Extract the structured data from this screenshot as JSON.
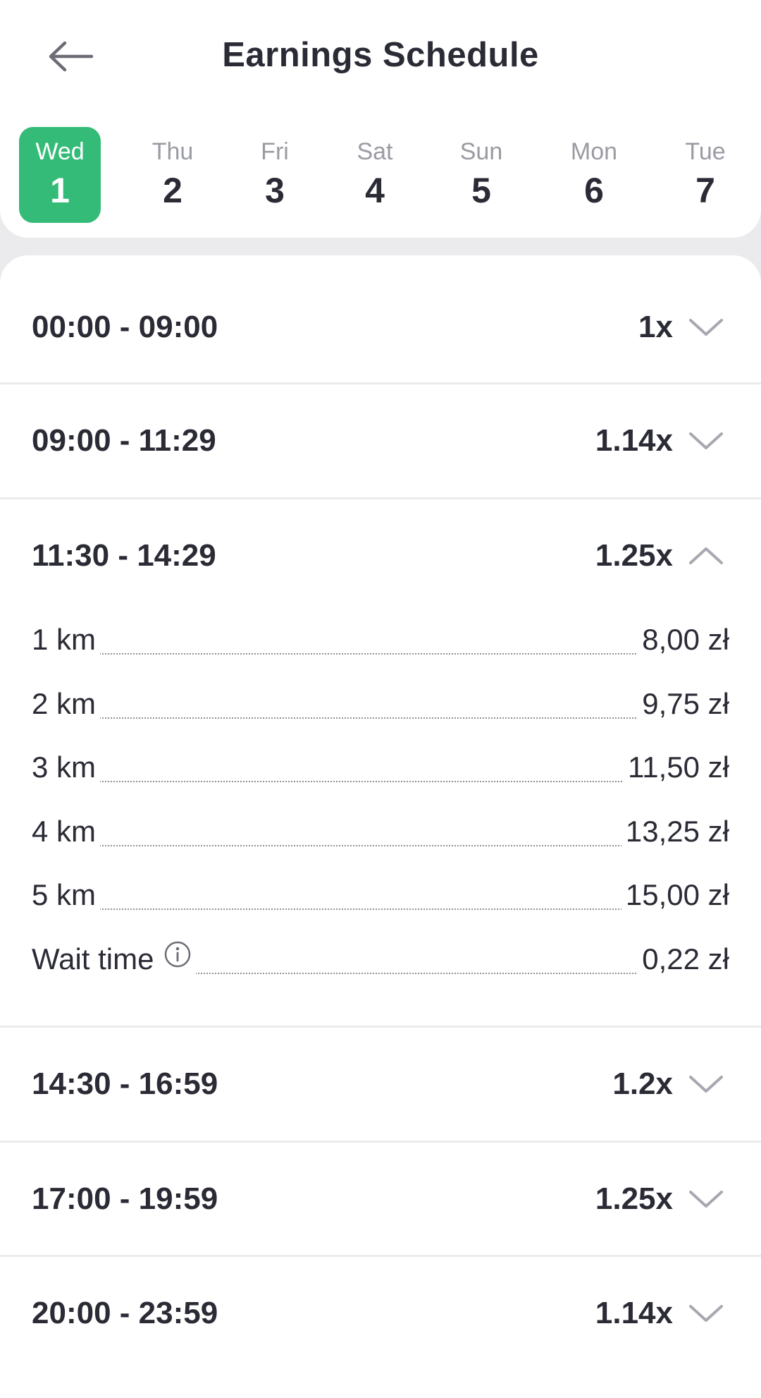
{
  "header": {
    "title": "Earnings Schedule"
  },
  "days": [
    {
      "name": "Wed",
      "num": "1",
      "selected": true
    },
    {
      "name": "Thu",
      "num": "2"
    },
    {
      "name": "Fri",
      "num": "3"
    },
    {
      "name": "Sat",
      "num": "4"
    },
    {
      "name": "Sun",
      "num": "5"
    },
    {
      "name": "Mon",
      "num": "6"
    },
    {
      "name": "Tue",
      "num": "7"
    }
  ],
  "slots": [
    {
      "range": "00:00 - 09:00",
      "multiplier": "1x",
      "expanded": false
    },
    {
      "range": "09:00 - 11:29",
      "multiplier": "1.14x",
      "expanded": false
    },
    {
      "range": "11:30 - 14:29",
      "multiplier": "1.25x",
      "expanded": true,
      "rates": [
        {
          "label": "1 km",
          "value": "8,00 zł"
        },
        {
          "label": "2 km",
          "value": "9,75 zł"
        },
        {
          "label": "3 km",
          "value": "11,50 zł"
        },
        {
          "label": "4 km",
          "value": "13,25 zł"
        },
        {
          "label": "5 km",
          "value": "15,00 zł"
        },
        {
          "label": "Wait time",
          "value": "0,22 zł",
          "icon": "info-icon"
        }
      ]
    },
    {
      "range": "14:30 - 16:59",
      "multiplier": "1.2x",
      "expanded": false
    },
    {
      "range": "17:00 - 19:59",
      "multiplier": "1.25x",
      "expanded": false
    },
    {
      "range": "20:00 - 23:59",
      "multiplier": "1.14x",
      "expanded": false
    }
  ],
  "colors": {
    "accent": "#35bb78",
    "text": "#2a2b35",
    "muted": "#9a9ba3",
    "background": "#ebebed"
  }
}
